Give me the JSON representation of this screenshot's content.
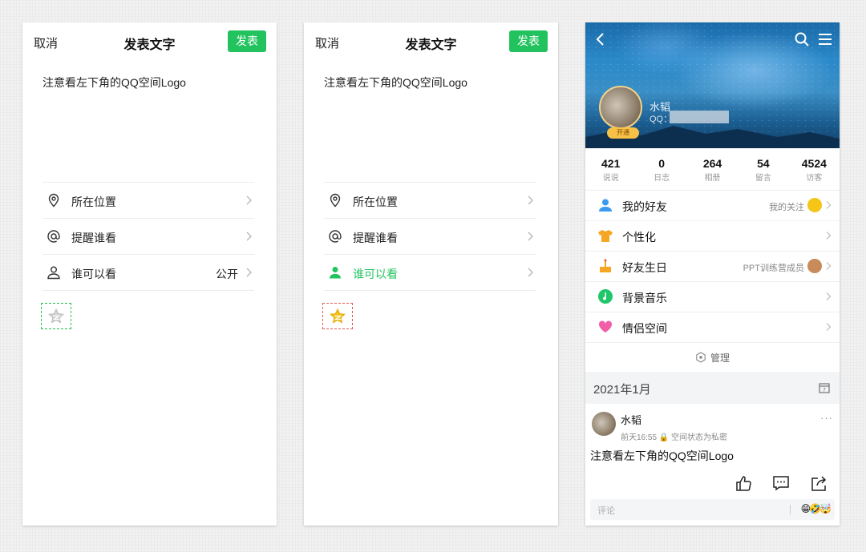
{
  "compose": {
    "cancel": "取消",
    "title": "发表文字",
    "publish": "发表",
    "content": "注意看左下角的QQ空间Logo",
    "options": {
      "location": "所在位置",
      "remind": "提醒谁看",
      "visibility": "谁可以看",
      "visibility_value": "公开"
    }
  },
  "profile": {
    "name": "水韬",
    "qq_prefix": "QQ：",
    "kaitong": "开通",
    "stats": [
      {
        "num": "421",
        "label": "说说"
      },
      {
        "num": "0",
        "label": "日志"
      },
      {
        "num": "264",
        "label": "相册"
      },
      {
        "num": "54",
        "label": "留言"
      },
      {
        "num": "4524",
        "label": "访客"
      }
    ],
    "menu": {
      "friends": "我的好友",
      "friends_extra": "我的关注",
      "personalize": "个性化",
      "birthday": "好友生日",
      "birthday_extra": "PPT训练营成员",
      "music": "背景音乐",
      "couple": "情侣空间"
    },
    "manage": "管理",
    "date": "2021年1月",
    "post": {
      "author": "水韬",
      "meta": "前天16:55  🔒 空间状态为私密",
      "text": "注意看左下角的QQ空间Logo",
      "more": "···",
      "comment_placeholder": "评论",
      "emojis": "😁🤣🤯"
    },
    "colors": {
      "green": "#22c35e",
      "accent": "#1a79c2"
    }
  }
}
